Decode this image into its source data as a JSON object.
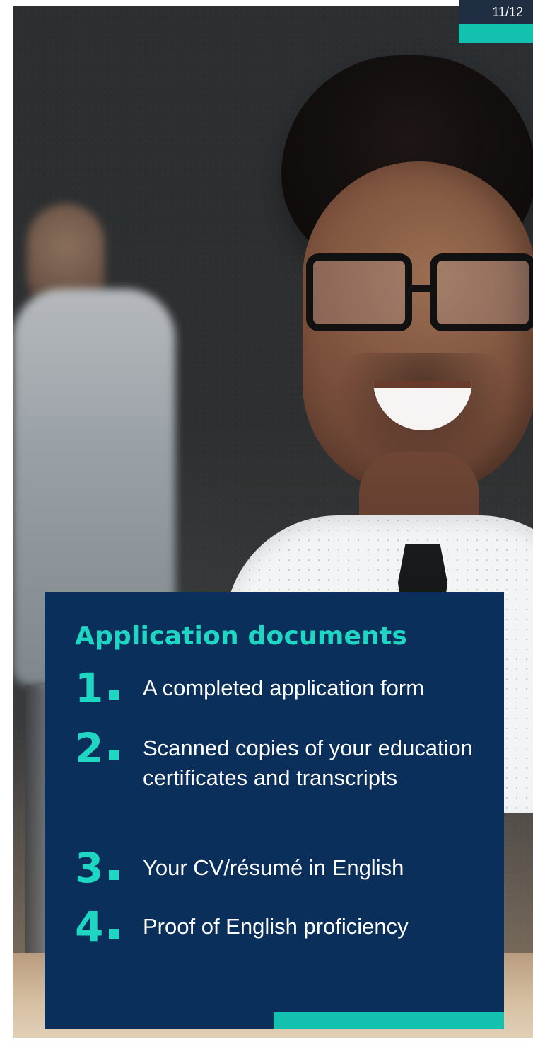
{
  "page": {
    "indicator_text": "11/12"
  },
  "card": {
    "title": "Application documents",
    "items": [
      {
        "number": "1",
        "text": "A completed application form"
      },
      {
        "number": "2",
        "text": "Scanned copies of your education certificates and transcripts"
      },
      {
        "number": "3",
        "text": "Your CV/résumé in English"
      },
      {
        "number": "4",
        "text": "Proof of English proficiency"
      }
    ]
  },
  "colors": {
    "navy": "#0a2f5b",
    "teal": "#12c2ae",
    "teal_text": "#1ed6c2",
    "indicator_bg": "#1f2e43"
  }
}
